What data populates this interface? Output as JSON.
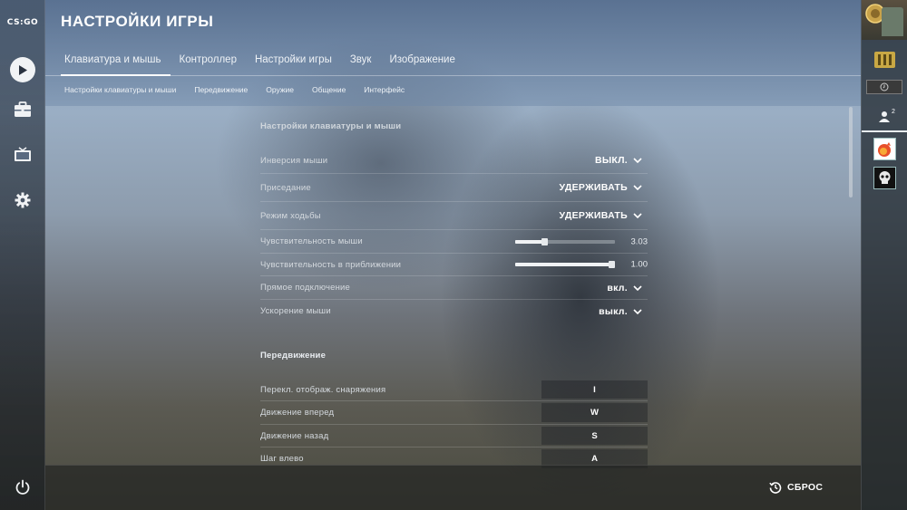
{
  "app": {
    "logo_text": "CS:GO"
  },
  "header": {
    "title": "НАСТРОЙКИ ИГРЫ",
    "tabs": [
      {
        "label": "Клавиатура и мышь",
        "active": true
      },
      {
        "label": "Контроллер",
        "active": false
      },
      {
        "label": "Настройки игры",
        "active": false
      },
      {
        "label": "Звук",
        "active": false
      },
      {
        "label": "Изображение",
        "active": false
      }
    ],
    "subtabs": [
      {
        "label": "Настройки клавиатуры и мыши"
      },
      {
        "label": "Передвижение"
      },
      {
        "label": "Оружие"
      },
      {
        "label": "Общение"
      },
      {
        "label": "Интерфейс"
      }
    ]
  },
  "sidebar": {
    "items": [
      {
        "icon": "play-icon"
      },
      {
        "icon": "briefcase-icon"
      },
      {
        "icon": "tv-icon"
      },
      {
        "icon": "gear-icon"
      }
    ],
    "power_icon": "power-icon"
  },
  "right_bar": {
    "friends_count": "2"
  },
  "settings": {
    "section_title": "Настройки клавиатуры и мыши",
    "rows": [
      {
        "label": "Инверсия мыши",
        "value": "ВЫКЛ."
      },
      {
        "label": "Приседание",
        "value": "УДЕРЖИВАТЬ"
      },
      {
        "label": "Режим ходьбы",
        "value": "УДЕРЖИВАТЬ"
      }
    ],
    "sliders": [
      {
        "label": "Чувствительность мыши",
        "value": "3.03",
        "fraction": 0.3
      },
      {
        "label": "Чувствительность в приближении",
        "value": "1.00",
        "fraction": 0.97
      }
    ],
    "rows2": [
      {
        "label": "Прямое подключение",
        "value": "вкл."
      },
      {
        "label": "Ускорение мыши",
        "value": "выкл."
      }
    ]
  },
  "movement": {
    "section_title": "Передвижение",
    "keys": [
      {
        "label": "Перекл. отображ. снаряжения",
        "key": "I"
      },
      {
        "label": "Движение вперед",
        "key": "W"
      },
      {
        "label": "Движение назад",
        "key": "S"
      },
      {
        "label": "Шаг влево",
        "key": "A"
      }
    ]
  },
  "footer": {
    "reset_label": "СБРОС"
  },
  "colors": {
    "accent": "#ffffff",
    "header_bg": "#4a6a90",
    "footer_bg": "#232422"
  }
}
